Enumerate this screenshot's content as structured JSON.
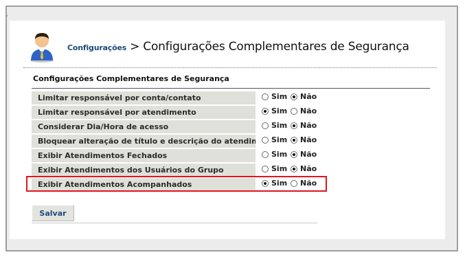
{
  "header": {
    "breadcrumb_link": "Configurações",
    "title": "> Configurações Complementares de Segurança"
  },
  "section": {
    "title": "Configurações Complementares de Segurança"
  },
  "options": {
    "yes": "Sim",
    "no": "Não"
  },
  "rows": [
    {
      "label": "Limitar responsável por conta/contato",
      "selected": "no"
    },
    {
      "label": "Limitar responsável por atendimento",
      "selected": "yes"
    },
    {
      "label": "Considerar Dia/Hora de acesso",
      "selected": "no"
    },
    {
      "label": "Bloquear alteração de título e descrição do atendimento",
      "selected": "no"
    },
    {
      "label": "Exibir Atendimentos Fechados",
      "selected": "no"
    },
    {
      "label": "Exibir Atendimentos dos Usuários do Grupo",
      "selected": "no"
    },
    {
      "label": "Exibir Atendimentos Acompanhados",
      "selected": "yes",
      "highlighted": true
    }
  ],
  "actions": {
    "save_label": "Salvar"
  },
  "colors": {
    "highlight": "#e0141e",
    "link": "#1c4a7c",
    "row_bg": "#dfe0d9"
  },
  "icons": {
    "avatar": "user-avatar-icon",
    "radio": "radio-button-icon"
  }
}
